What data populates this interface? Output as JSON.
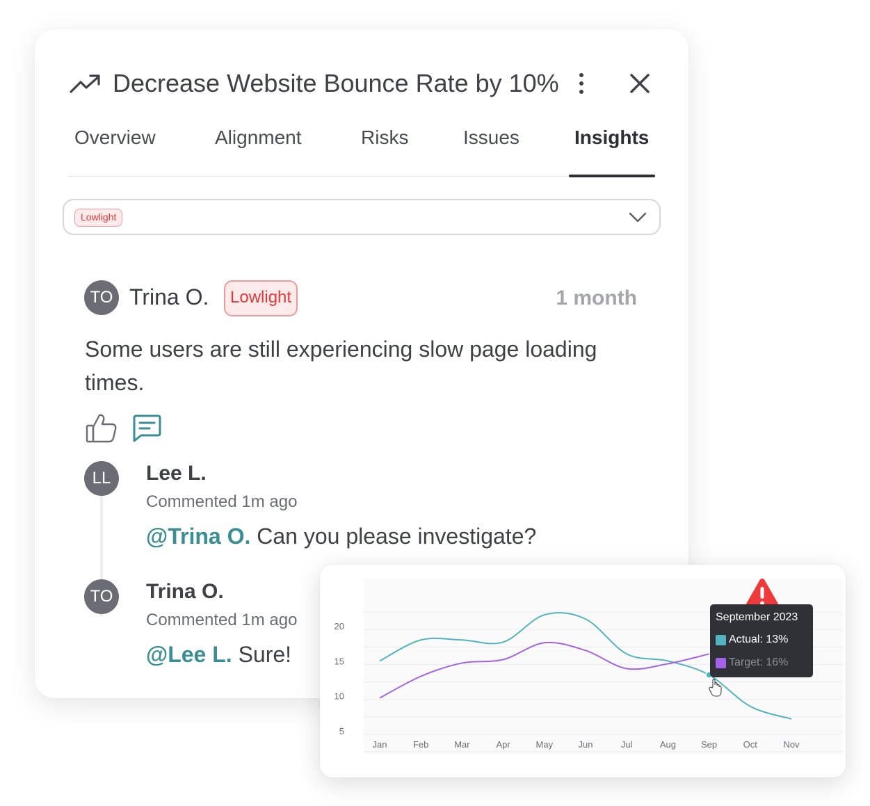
{
  "header": {
    "title": "Decrease Website Bounce Rate by 10%",
    "trend_icon": "trending-up-icon",
    "menu_icon": "kebab-menu-icon",
    "close_icon": "close-icon"
  },
  "tabs": [
    {
      "label": "Overview",
      "active": false
    },
    {
      "label": "Alignment",
      "active": false
    },
    {
      "label": "Risks",
      "active": false
    },
    {
      "label": "Issues",
      "active": false
    },
    {
      "label": "Insights",
      "active": true
    }
  ],
  "filter": {
    "selected": "Lowlight"
  },
  "post": {
    "initials": "TO",
    "author": "Trina O.",
    "badge": "Lowlight",
    "time": "1 month",
    "text": "Some users are still experiencing slow page loading times.",
    "like_icon": "thumbs-up-icon",
    "comment_icon": "comment-icon"
  },
  "comments": [
    {
      "initials": "LL",
      "author": "Lee L.",
      "meta": "Commented 1m ago",
      "mention": "@Trina O.",
      "text": " Can you please investigate?"
    },
    {
      "initials": "TO",
      "author": "Trina O.",
      "meta": "Commented 1m ago",
      "mention": "@Lee L.",
      "text": " Sure!"
    }
  ],
  "colors": {
    "accent": "#3a8e95",
    "lowlight": "#e23b3b",
    "actual": "#52b3c1",
    "target": "#a463e6",
    "warning": "#ee3a3a"
  },
  "chart_data": {
    "type": "line",
    "categories": [
      "Jan",
      "Feb",
      "Mar",
      "Apr",
      "May",
      "Jun",
      "Jul",
      "Aug",
      "Sep",
      "Oct",
      "Nov"
    ],
    "y_ticks": [
      20,
      15,
      10,
      5
    ],
    "ylim": [
      2,
      24
    ],
    "grid": true,
    "series": [
      {
        "name": "Actual",
        "values": [
          15,
          18,
          18,
          17.7,
          21.6,
          21,
          16,
          15,
          13,
          8.5,
          6.7
        ]
      },
      {
        "name": "Target",
        "values": [
          9.7,
          12.8,
          14.7,
          15.2,
          17.6,
          16.5,
          13.9,
          14.6,
          16
        ]
      }
    ],
    "tooltip": {
      "title": "September 2023",
      "actual": "Actual: 13%",
      "target": "Target: 16%"
    },
    "warning_icon": "warning-triangle-icon"
  }
}
